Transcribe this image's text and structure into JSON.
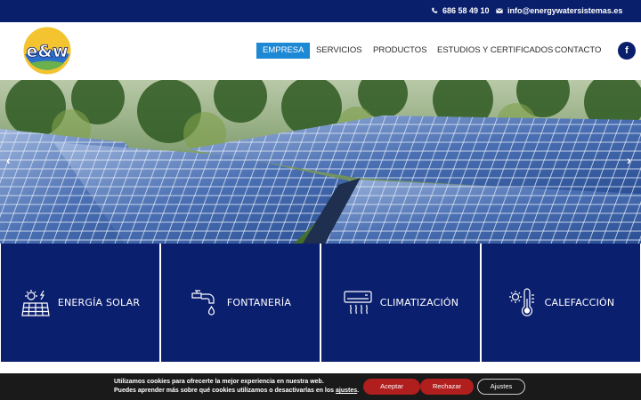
{
  "topbar": {
    "phone": "686 58 49 10",
    "email": "info@energywatersistemas.es"
  },
  "logo": {
    "text": "e&w"
  },
  "nav": {
    "items": [
      "EMPRESA",
      "SERVICIOS",
      "PRODUCTOS",
      "ESTUDIOS Y CERTIFICADOS",
      "CONTACTO"
    ],
    "active": "EMPRESA"
  },
  "social": {
    "facebook": "f"
  },
  "hero": {
    "prev": "‹",
    "next": "›"
  },
  "services": [
    {
      "label": "ENERGÍA SOLAR",
      "icon": "solar-panel-icon"
    },
    {
      "label": "FONTANERÍA",
      "icon": "faucet-icon"
    },
    {
      "label": "CLIMATIZACIÓN",
      "icon": "air-conditioner-icon"
    },
    {
      "label": "CALEFACCIÓN",
      "icon": "thermometer-icon"
    }
  ],
  "cookie": {
    "line1": "Utilizamos cookies para ofrecerte la mejor experiencia en nuestra web.",
    "line2_pre": "Puedes aprender más sobre qué cookies utilizamos o desactivarlas en los ",
    "line2_link": "ajustes",
    "line2_post": ".",
    "accept": "Aceptar",
    "reject": "Rechazar",
    "settings": "Ajustes"
  },
  "colors": {
    "navy": "#0a1f6b",
    "accent": "#1d88d4",
    "red": "#b01e1e"
  }
}
